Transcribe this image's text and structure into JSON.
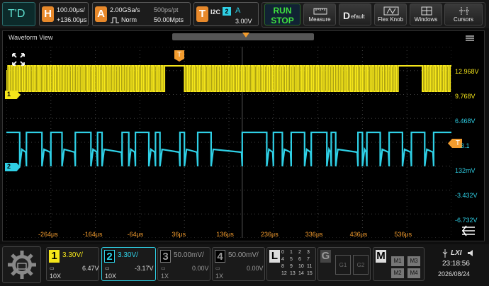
{
  "logo": "T'D",
  "horizontal": {
    "badge": "H",
    "timebase": "100.00μs/",
    "offset": "+136.00μs"
  },
  "acquire": {
    "badge": "A",
    "sample_rate": "2.00GSa/s",
    "mode": "Norm",
    "pts_per_div": "500ps/pt",
    "memory": "50.00Mpts"
  },
  "trigger": {
    "badge": "T",
    "type": "I2C",
    "source": "2",
    "edge": "A",
    "level": "3.00V"
  },
  "run_stop": {
    "line1": "RUN",
    "line2": "STOP"
  },
  "toolbar": {
    "measure": "Measure",
    "default_icon": "D",
    "default": "efault",
    "flex_knob": "Flex Knob",
    "windows": "Windows",
    "cursors": "Cursors"
  },
  "waveform_view": {
    "title": "Waveform View",
    "trigger_marker": "T",
    "ch1_marker": "1",
    "ch2_marker": "2",
    "ch2_trig_marker": "T",
    "volt_labels": [
      "12.968V",
      "9.768V",
      "6.468V",
      "3.1",
      "132mV",
      "-3.432V",
      "-6.732V"
    ],
    "time_labels": [
      "-264μs",
      "-164μs",
      "-64μs",
      "36μs",
      "136μs",
      "236μs",
      "336μs",
      "436μs",
      "536μs"
    ]
  },
  "channels": [
    {
      "num": "1",
      "scale": "3.30V/",
      "probe": "10X",
      "offset": "6.47V",
      "color": "#f5e61a"
    },
    {
      "num": "2",
      "scale": "3.30V/",
      "probe": "10X",
      "offset": "-3.17V",
      "color": "#2fd0e6"
    },
    {
      "num": "3",
      "scale": "50.00mV/",
      "probe": "1X",
      "offset": "0.00V",
      "color": "#888888"
    },
    {
      "num": "4",
      "scale": "50.00mV/",
      "probe": "1X",
      "offset": "0.00V",
      "color": "#888888"
    }
  ],
  "logic": {
    "badge": "L",
    "channels": [
      "0",
      "1",
      "2",
      "3",
      "4",
      "5",
      "6",
      "7",
      "8",
      "9",
      "10",
      "11",
      "12",
      "13",
      "14",
      "15"
    ]
  },
  "gen": {
    "badge": "G",
    "g1": "G1",
    "g2": "G2"
  },
  "math": {
    "badge": "M",
    "items": [
      "M1",
      "M3",
      "M2",
      "M4"
    ]
  },
  "status": {
    "lxi": "LXI",
    "time": "23:18:56",
    "date": "2026/08/24"
  }
}
